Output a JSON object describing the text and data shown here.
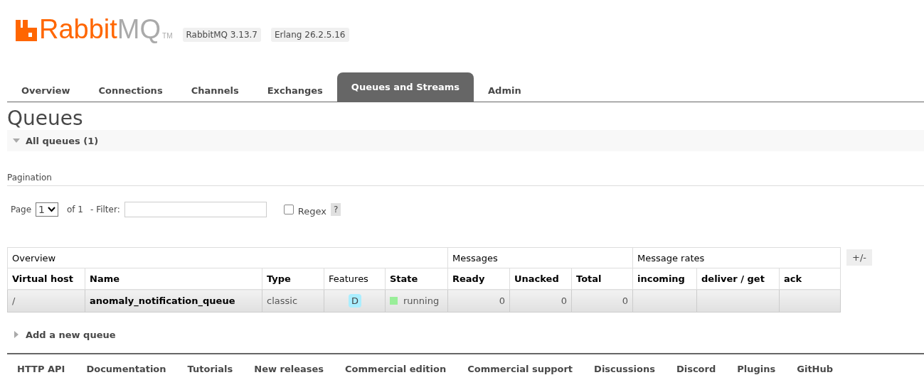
{
  "header": {
    "logo": {
      "brand_main": "Rabbit",
      "brand_accent": "MQ",
      "trademark": "TM"
    },
    "versions": [
      "RabbitMQ 3.13.7",
      "Erlang 26.2.5.16"
    ]
  },
  "tabs": [
    {
      "label": "Overview",
      "selected": false
    },
    {
      "label": "Connections",
      "selected": false
    },
    {
      "label": "Channels",
      "selected": false
    },
    {
      "label": "Exchanges",
      "selected": false
    },
    {
      "label": "Queues and Streams",
      "selected": true
    },
    {
      "label": "Admin",
      "selected": false
    }
  ],
  "page_title": "Queues",
  "section": {
    "title": "All queues (1)",
    "expanded": true
  },
  "pagination": {
    "label": "Pagination",
    "page_label": "Page",
    "page_value": "1",
    "of_label": "of 1",
    "filter_label": "- Filter:",
    "regex_label": "Regex",
    "regex_checked": false,
    "help": "?"
  },
  "table": {
    "groups": [
      {
        "label": "Overview",
        "columns": [
          {
            "label": "Virtual host",
            "bold": true
          },
          {
            "label": "Name",
            "bold": true
          },
          {
            "label": "Type",
            "bold": true
          },
          {
            "label": "Features",
            "bold": false
          },
          {
            "label": "State",
            "bold": true
          }
        ]
      },
      {
        "label": "Messages",
        "columns": [
          {
            "label": "Ready",
            "bold": true
          },
          {
            "label": "Unacked",
            "bold": true
          },
          {
            "label": "Total",
            "bold": true
          }
        ]
      },
      {
        "label": "Message rates",
        "columns": [
          {
            "label": "incoming",
            "bold": true
          },
          {
            "label": "deliver / get",
            "bold": true
          },
          {
            "label": "ack",
            "bold": true
          }
        ]
      }
    ],
    "rows": [
      {
        "cells": [
          {
            "kind": "text",
            "text": "/"
          },
          {
            "kind": "name",
            "text": "anomaly_notification_queue"
          },
          {
            "kind": "text",
            "text": "classic"
          },
          {
            "kind": "badge",
            "text": "D"
          },
          {
            "kind": "state",
            "text": "running",
            "color": "#99ee99"
          },
          {
            "kind": "number",
            "text": "0"
          },
          {
            "kind": "number",
            "text": "0"
          },
          {
            "kind": "number",
            "text": "0"
          }
        ]
      }
    ],
    "toggle_columns": "+/-"
  },
  "add_section": {
    "title": "Add a new queue",
    "expanded": false
  },
  "footer_links": [
    "HTTP API",
    "Documentation",
    "Tutorials",
    "New releases",
    "Commercial edition",
    "Commercial support",
    "Discussions",
    "Discord",
    "Plugins",
    "GitHub"
  ]
}
